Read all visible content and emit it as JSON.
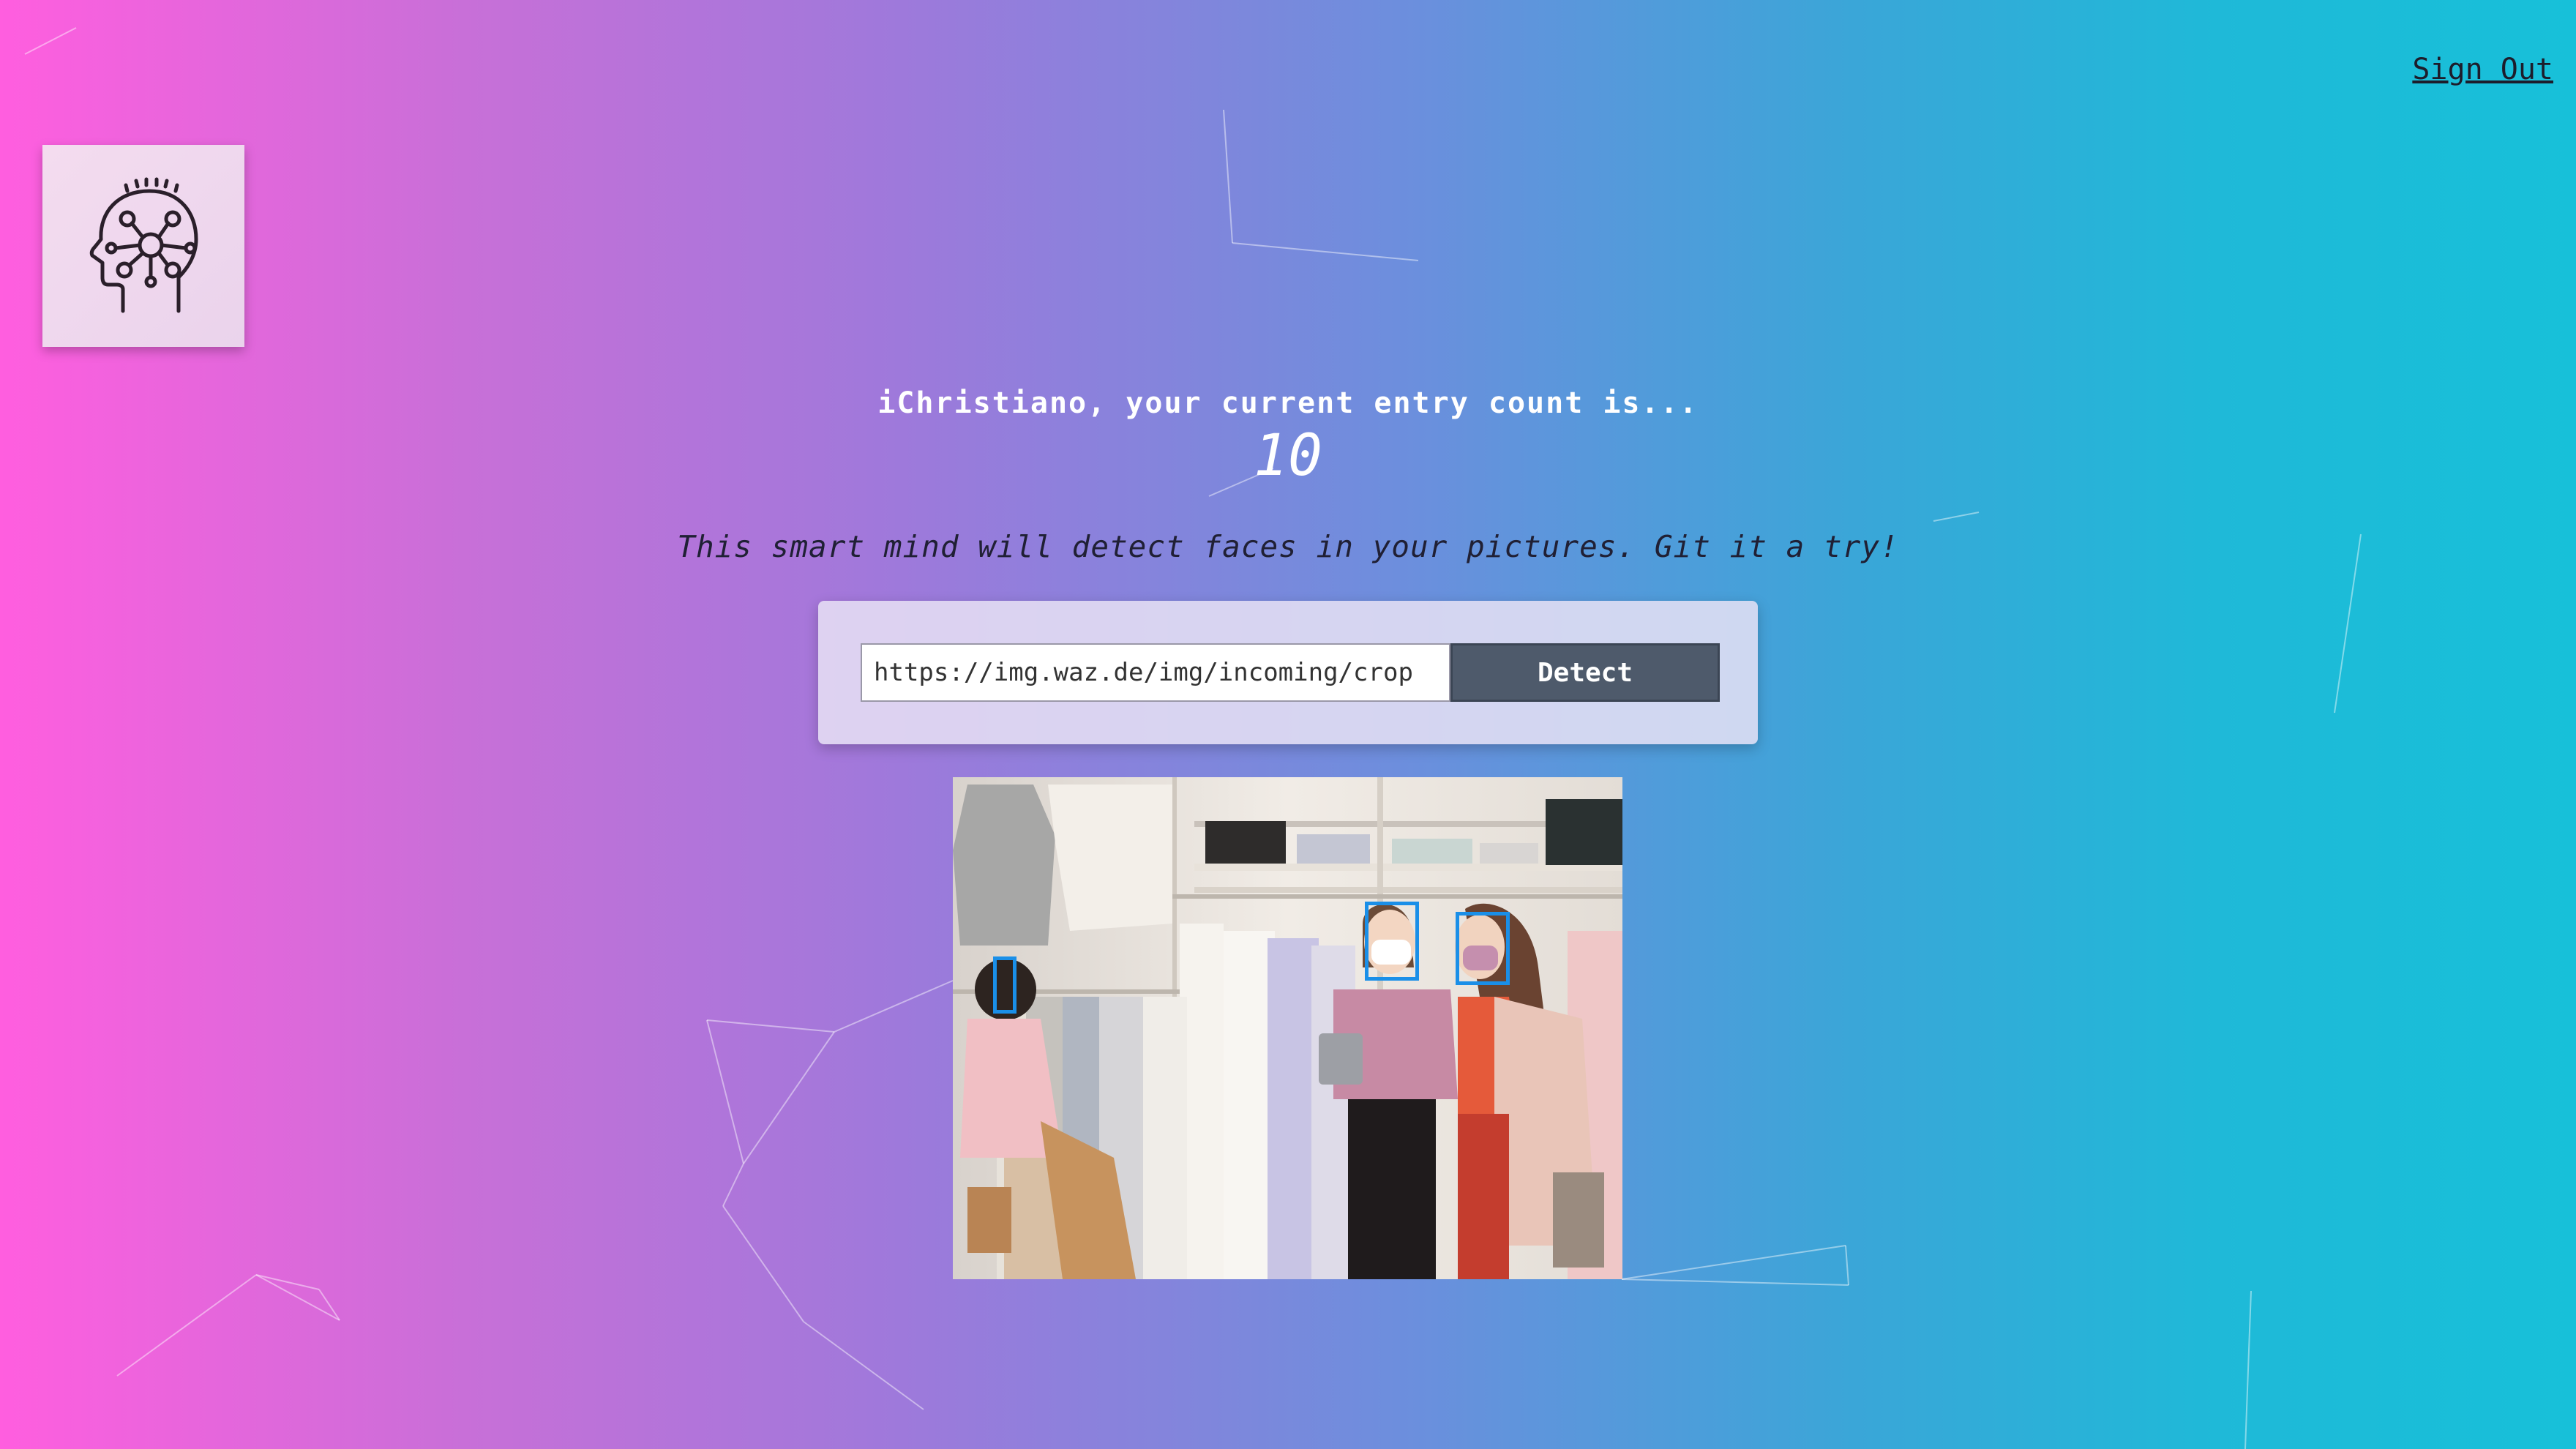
{
  "header": {
    "sign_out_label": "Sign Out"
  },
  "logo": {
    "icon": "brain-network-head-icon"
  },
  "entry": {
    "greeting": "iChristiano, your current entry count is...",
    "count": "10"
  },
  "tagline": "This smart mind will detect faces in your pictures. Git it a try!",
  "form": {
    "url_value": "https://img.waz.de/img/incoming/crop",
    "detect_label": "Detect"
  },
  "result": {
    "face_boxes_count": 3,
    "box_color": "#1a8fe8"
  },
  "colors": {
    "gradient_left": "#ff5edf",
    "gradient_right": "#17c0d9",
    "button_bg": "#4e5a6b"
  }
}
